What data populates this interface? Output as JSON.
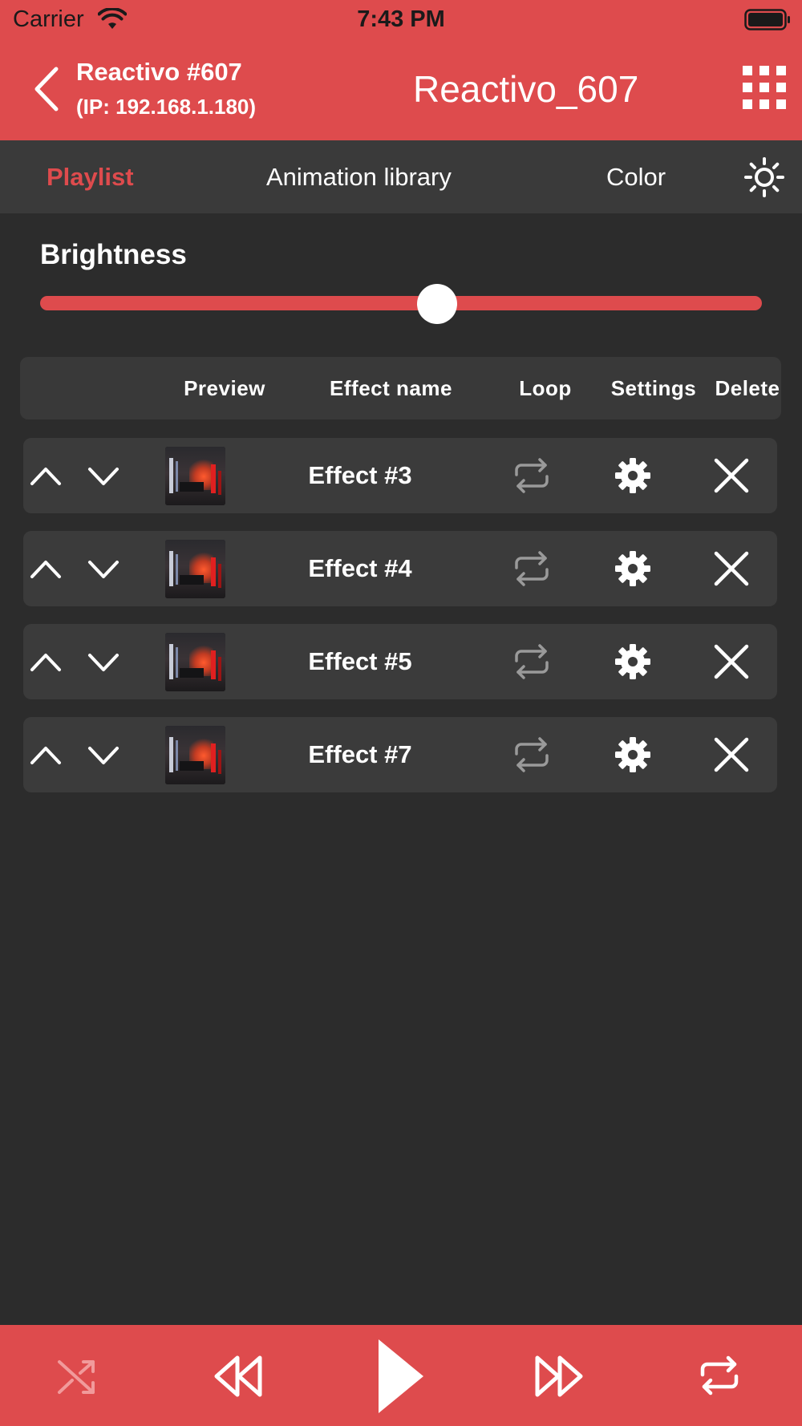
{
  "status_bar": {
    "carrier": "Carrier",
    "time": "7:43 PM",
    "icons": [
      "wifi-icon",
      "battery-icon"
    ]
  },
  "header": {
    "device_name": "Reactivo #607",
    "device_ip": "(IP: 192.168.1.180)",
    "title": "Reactivo_607",
    "icons": [
      "back-chevron-icon",
      "grid-menu-icon"
    ]
  },
  "tabs": [
    {
      "label": "Playlist",
      "active": true
    },
    {
      "label": "Animation library",
      "active": false
    },
    {
      "label": "Color",
      "active": false
    }
  ],
  "tab_icons": [
    "sun-icon"
  ],
  "brightness": {
    "label": "Brightness",
    "value_fraction": 0.55
  },
  "table": {
    "columns": [
      "Preview",
      "Effect name",
      "Loop",
      "Settings",
      "Delete"
    ],
    "rows": [
      {
        "name": "Effect #3"
      },
      {
        "name": "Effect #4"
      },
      {
        "name": "Effect #5"
      },
      {
        "name": "Effect #7"
      }
    ],
    "row_icons": [
      "chevron-up-icon",
      "chevron-down-icon",
      "preview-thumbnail",
      "loop-icon",
      "gear-icon",
      "close-icon"
    ]
  },
  "player": {
    "icons": [
      "shuffle-icon",
      "rewind-icon",
      "play-icon",
      "fast-forward-icon",
      "repeat-icon"
    ],
    "shuffle_enabled": false
  },
  "colors": {
    "accent": "#de4b4d",
    "background": "#2c2c2c",
    "tab_bar": "#3a3a3a",
    "row": "#3b3b3b",
    "loop_inactive": "#9a9a9a"
  }
}
